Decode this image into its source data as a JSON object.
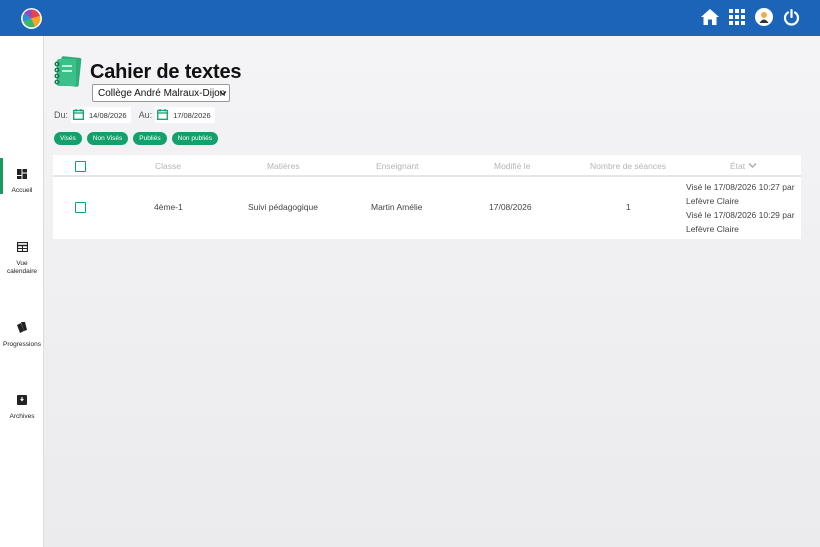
{
  "header": {
    "icons": [
      "home-icon",
      "apps-grid-icon",
      "user-avatar-icon",
      "power-icon"
    ]
  },
  "sidebar": {
    "items": [
      {
        "label": "Accueil",
        "icon": "dashboard-icon",
        "active": true
      },
      {
        "label": "Vue calendaire",
        "icon": "calendar-grid-icon",
        "active": false
      },
      {
        "label": "Progressions",
        "icon": "cards-icon",
        "active": false
      },
      {
        "label": "Archives",
        "icon": "archive-box-icon",
        "active": false
      }
    ]
  },
  "page": {
    "title": "Cahier de textes",
    "school": "Collège André Malraux-Dijon"
  },
  "dates": {
    "from_label": "Du:",
    "from_value": "14/08/2026",
    "to_label": "Au:",
    "to_value": "17/08/2026"
  },
  "filters": [
    "Visés",
    "Non Visés",
    "Publiés",
    "Non publiés"
  ],
  "table": {
    "headers": {
      "classe": "Classe",
      "matieres": "Matières",
      "enseignant": "Enseignant",
      "modifie": "Modifié le",
      "seances": "Nombre de séances",
      "etat": "État"
    },
    "rows": [
      {
        "classe": "4ème-1",
        "matiere": "Suivi pédagogique",
        "enseignant": "Martin Amélie",
        "modifie": "17/08/2026",
        "seances": "1",
        "etat_1a": "Visé le 17/08/2026 10:27 par",
        "etat_1b": "Lefèvre Claire",
        "etat_2a": "Visé le 17/08/2026 10:29 par",
        "etat_2b": "Lefèvre Claire"
      }
    ]
  },
  "colors": {
    "topbar": "#1c64b8",
    "accent_green": "#14a06a"
  }
}
